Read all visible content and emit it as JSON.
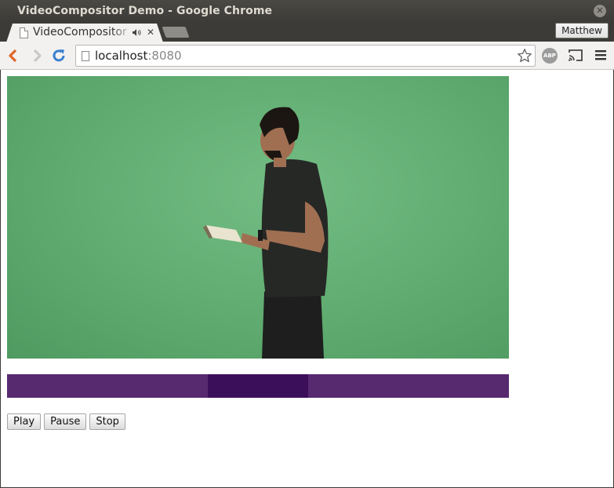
{
  "window": {
    "title": "VideoCompositor Demo - Google Chrome"
  },
  "tab": {
    "title": "VideoCompositor Demo",
    "audio_icon": "speaker-icon",
    "close_icon": "close-icon"
  },
  "profile": {
    "name": "Matthew"
  },
  "omnibox": {
    "host": "localhost",
    "port": ":8080"
  },
  "video": {
    "description_icon": "video-frame"
  },
  "timeline": {
    "colors": {
      "track": "#572a70",
      "active_clip": "#3c0f5a"
    },
    "active_clip_start_fraction": 0.4,
    "active_clip_end_fraction": 0.6
  },
  "controls": {
    "play_label": "Play",
    "pause_label": "Pause",
    "stop_label": "Stop"
  },
  "toolbar": {
    "abp_label": "ABP"
  }
}
